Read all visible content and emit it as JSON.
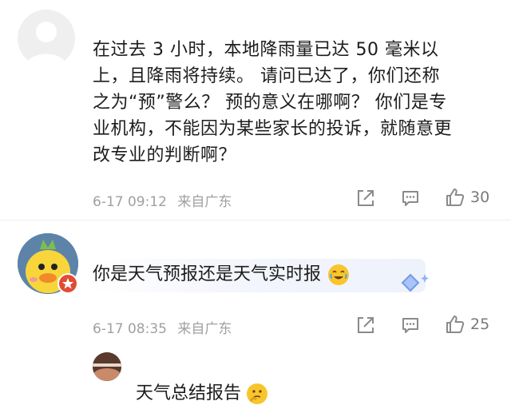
{
  "comments": [
    {
      "lines": [
        "在过去 3 小时，本地降雨量已达 50 毫米以",
        "上，且降雨将持续。 请问已达了，你们还称",
        "之为“预”警么？ 预的意义在哪啊？ 你们是专",
        "业机构，不能因为某些家长的投诉，就随意更",
        "改专业的判断啊？"
      ],
      "timestamp": "6-17 09:12",
      "location": "来自广东",
      "likes": "30"
    },
    {
      "text": "你是天气预报还是天气实时报",
      "timestamp": "6-17 08:35",
      "location": "来自广东",
      "likes": "25"
    }
  ],
  "reply": {
    "text": "天气总结报告"
  },
  "icons": {
    "share": "share-icon",
    "comment": "comment-icon",
    "like": "like-icon",
    "emoji_laugh": "laughing-crying-emoji",
    "emoji_think": "thinking-emoji"
  },
  "colors": {
    "text": "#1c1c1c",
    "meta": "#a0a0a0",
    "badge": "#e34b33"
  }
}
